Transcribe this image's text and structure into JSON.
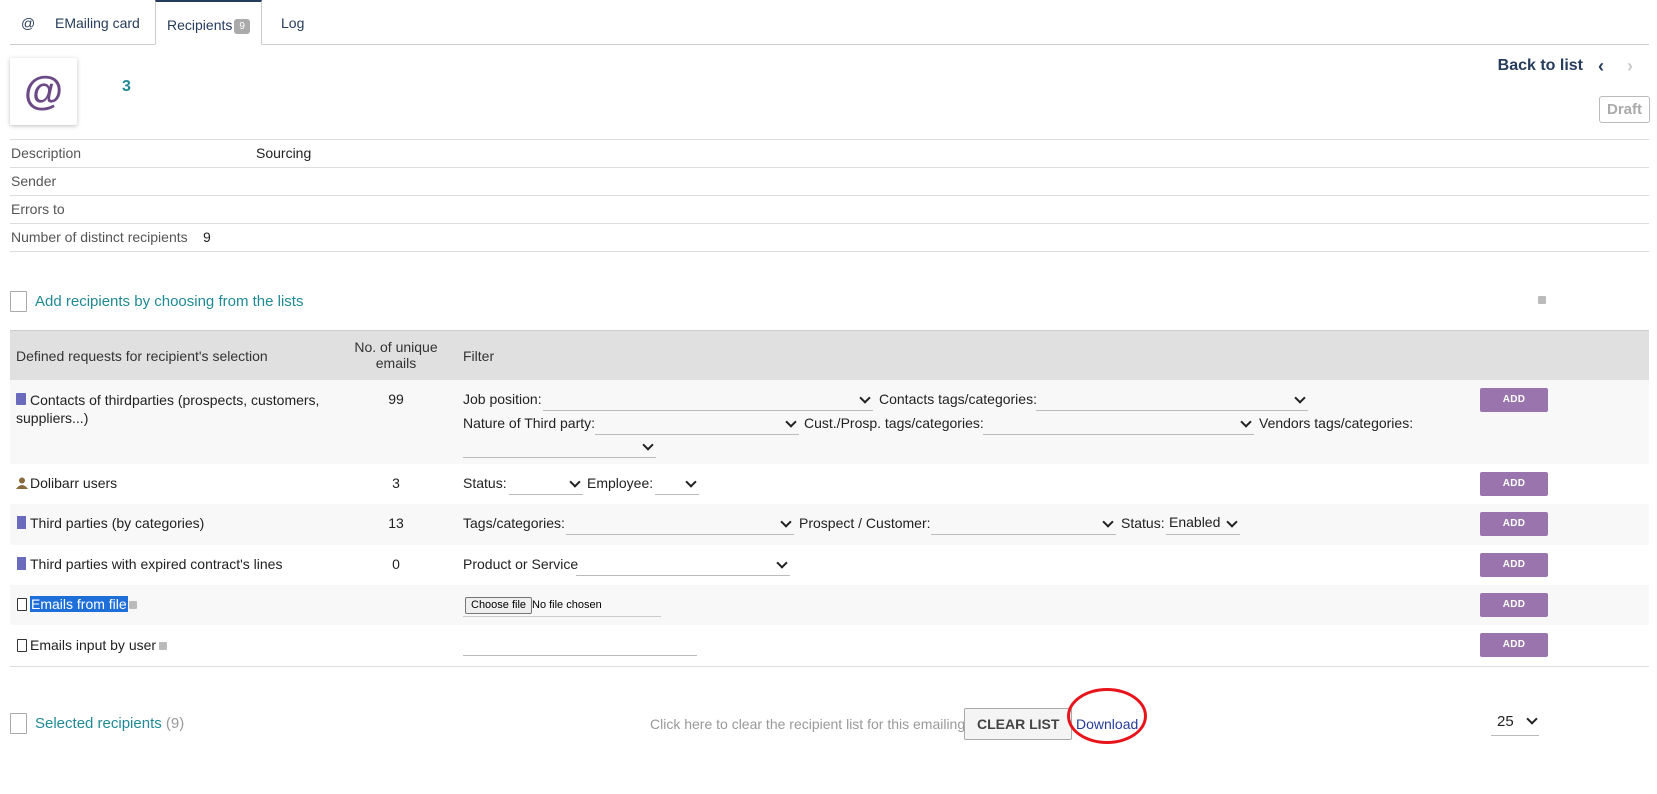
{
  "tabs": {
    "icon": "@",
    "items": [
      {
        "label": "EMailing card"
      },
      {
        "label": "Recipients",
        "badge": "9"
      },
      {
        "label": "Log"
      }
    ]
  },
  "header": {
    "logo_char": "@",
    "ref": "3",
    "back_to_list": "Back to list",
    "prev_icon": "‹",
    "next_icon": "›",
    "status": "Draft"
  },
  "info": {
    "description_label": "Description",
    "description_value": "Sourcing",
    "sender_label": "Sender",
    "sender_value": "",
    "errors_label": "Errors to",
    "errors_value": "",
    "distinct_label": "Number of distinct recipients",
    "distinct_value": "9"
  },
  "add_section": {
    "title": "Add recipients by choosing from the lists"
  },
  "table": {
    "col1": "Defined requests for recipient's selection",
    "col2_line1": "No. of unique",
    "col2_line2": "emails",
    "col3": "Filter",
    "add_label": "ADD",
    "rows": [
      {
        "label_line1": "Contacts of thirdparties (prospects, customers,",
        "label_line2": "suppliers...)",
        "count": "99",
        "f_job": "Job position:",
        "f_contacts_tags": "Contacts tags/categories:",
        "f_nature": "Nature of Third party:",
        "f_cust_tags": "Cust./Prosp. tags/categories:",
        "f_vendor_tags": "Vendors tags/categories:"
      },
      {
        "label": "Dolibarr users",
        "count": "3",
        "f_status": "Status:",
        "f_employee": "Employee:"
      },
      {
        "label": "Third parties (by categories)",
        "count": "13",
        "f_tags": "Tags/categories:",
        "f_prospect": "Prospect / Customer:",
        "f_status": "Status:",
        "f_status_value": "Enabled"
      },
      {
        "label": "Third parties with expired contract's lines",
        "count": "0",
        "f_product": "Product or Service"
      },
      {
        "label": "Emails from file",
        "file_button": "Choose file",
        "file_status": "No file chosen"
      },
      {
        "label": "Emails input by user"
      }
    ]
  },
  "selected_section": {
    "title": "Selected recipients",
    "count": "(9)",
    "clear_hint": "Click here to clear the recipient list for this emailing",
    "clear_button": "CLEAR LIST",
    "download": "Download",
    "page_size": "25"
  }
}
